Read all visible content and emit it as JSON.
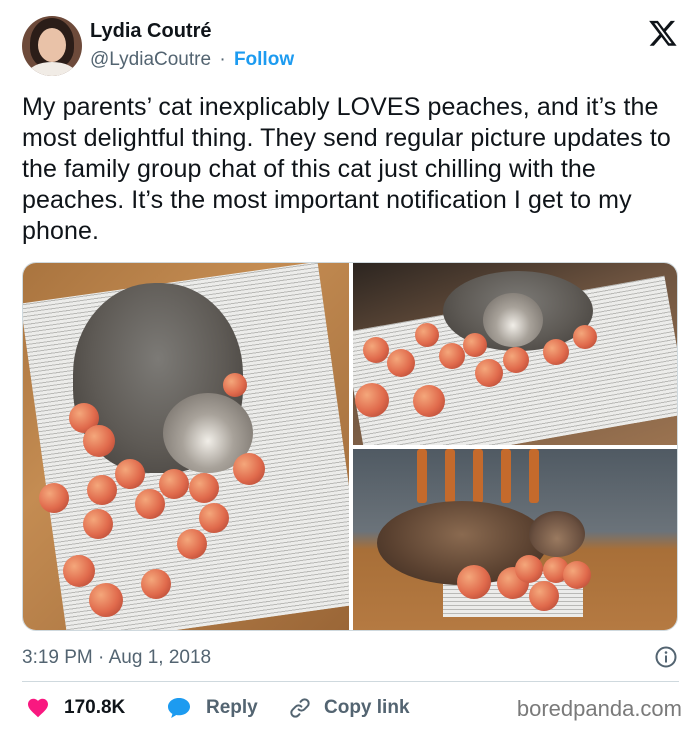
{
  "author": {
    "name": "Lydia Coutré",
    "handle": "@LydiaCoutre",
    "separator": "·",
    "follow_label": "Follow"
  },
  "tweet": {
    "text": "My parents’ cat inexplicably LOVES peaches, and it’s the most delightful thing. They send regular picture updates to the family group chat of this cat just chilling with the peaches. It’s the most important notification I get to my phone.",
    "time": "3:19 PM",
    "date": "Aug 1, 2018",
    "date_separator": "·"
  },
  "actions": {
    "like_count": "170.8K",
    "reply_label": "Reply",
    "copy_label": "Copy link"
  },
  "watermark": "boredpanda.com",
  "icons": {
    "brand": "x-logo-icon",
    "info": "info-icon",
    "like": "heart-icon",
    "reply": "reply-bubble-icon",
    "copy": "link-icon"
  },
  "colors": {
    "like": "#f91880",
    "reply": "#1d9bf0",
    "follow": "#1d9bf0",
    "secondary_text": "#536471",
    "primary_text": "#0f1419",
    "border": "#cfd9de"
  }
}
